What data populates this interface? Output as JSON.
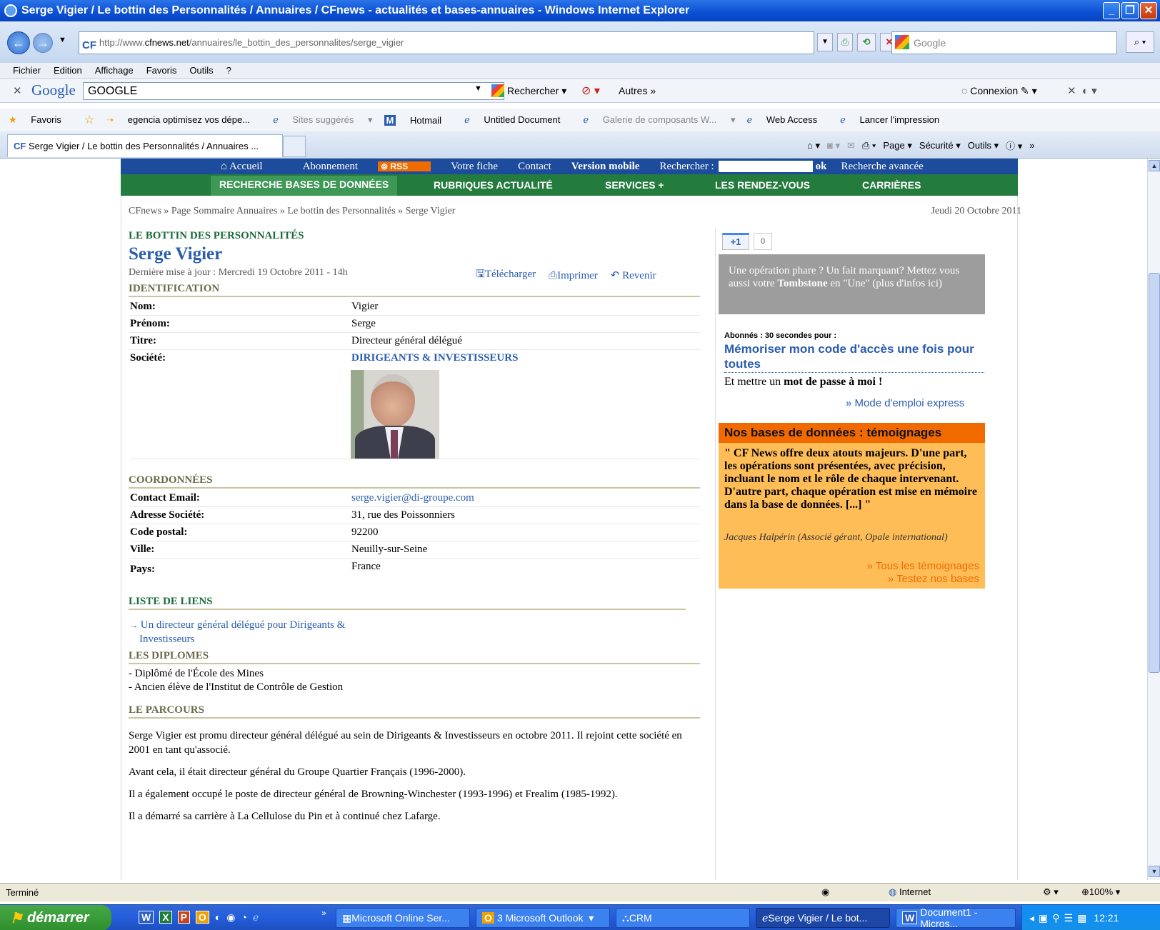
{
  "window": {
    "title": "Serge Vigier / Le bottin des Personnalités / Annuaires / CFnews - actualités et bases-annuaires - Windows Internet Explorer"
  },
  "address": {
    "url_pre": "http://www.",
    "url_host": "cfnews.net",
    "url_post": "/annuaires/le_bottin_des_personnalites/serge_vigier",
    "search_placeholder": "Google"
  },
  "menu": [
    "Fichier",
    "Edition",
    "Affichage",
    "Favoris",
    "Outils",
    "?"
  ],
  "gtoolbar": {
    "logo": "Google",
    "query": "GOOGLE",
    "search": "Rechercher",
    "more": "Autres",
    "connect": "Connexion"
  },
  "favorites": [
    "Favoris",
    "egencia optimisez vos dépe...",
    "Sites suggérés",
    "Hotmail",
    "Untitled Document",
    "Galerie de composants W...",
    "Web Access",
    "Lancer l'impression"
  ],
  "tab": {
    "title": "Serge Vigier / Le bottin des Personnalités / Annuaires ...",
    "page": "Page",
    "security": "Sécurité",
    "tools": "Outils"
  },
  "site": {
    "topnav": [
      "Accueil",
      "Abonnement",
      "RSS",
      "Votre fiche",
      "Contact",
      "Version mobile",
      "Rechercher :"
    ],
    "ok": "ok",
    "advanced": "Recherche avancée",
    "greennav": [
      "RECHERCHE BASES DE DONNÉES",
      "RUBRIQUES ACTUALITÉ",
      "SERVICES +",
      "LES RENDEZ-VOUS",
      "CARRIÈRES"
    ],
    "breadcrumb": "CFnews » Page Sommaire Annuaires » Le bottin des Personnalités » Serge Vigier",
    "date": "Jeudi 20 Octobre 2011"
  },
  "profile": {
    "section": "LE BOTTIN DES PERSONNALITÉS",
    "name": "Serge Vigier",
    "updated": "Dernière mise à jour : Mercredi 19 Octobre 2011 - 14h",
    "actions": [
      "Télécharger",
      "Imprimer",
      "Revenir"
    ],
    "ident_head": "IDENTIFICATION",
    "ident": [
      {
        "k": "Nom:",
        "v": "Vigier"
      },
      {
        "k": "Prénom:",
        "v": "Serge"
      },
      {
        "k": "Titre:",
        "v": "Directeur général délégué"
      },
      {
        "k": "Société:",
        "v": "DIRIGEANTS & INVESTISSEURS"
      }
    ],
    "coord_head": "COORDONNÉES",
    "coord": [
      {
        "k": "Contact Email:",
        "v": "serge.vigier@di-groupe.com"
      },
      {
        "k": "Adresse Société:",
        "v": "31, rue des Poissonniers"
      },
      {
        "k": "Code postal:",
        "v": "92200"
      },
      {
        "k": "Ville:",
        "v": "Neuilly-sur-Seine"
      },
      {
        "k": "Pays:",
        "v": "France"
      }
    ],
    "links_head": "LISTE DE LIENS",
    "link1": "Un directeur général délégué pour Dirigeants &",
    "link2": "Investisseurs",
    "dipl_head": "LES DIPLOMES",
    "dipl": [
      "- Diplômé de l'École des Mines",
      "- Ancien élève de l'Institut de Contrôle de Gestion"
    ],
    "parcours_head": "LE PARCOURS",
    "parcours": [
      "Serge Vigier est promu directeur général délégué au sein de Dirigeants & Investisseurs en octobre 2011. Il rejoint cette société en 2001 en tant qu'associé.",
      "Avant cela, il était directeur général du Groupe Quartier Français (1996-2000).",
      "Il a également occupé le poste de directeur général de Browning-Winchester (1993-1996) et Frealim (1985-1992).",
      "Il a démarré sa carrière à La Cellulose du Pin et à continué chez Lafarge."
    ]
  },
  "right": {
    "plus": "+1",
    "count": "0",
    "tomb1": "Une opération phare ? Un fait marquant? Mettez vous aussi votre ",
    "tomb_b": "Tombstone",
    "tomb2": " en \"Une\" (plus d'infos ici)",
    "abonnes": "Abonnés : 30 secondes pour :",
    "memo": "Mémoriser mon code d'accès une fois pour toutes",
    "pass_pre": "Et mettre un ",
    "pass_b": "mot de passe à moi !",
    "mode": "Mode d'emploi express",
    "temo_head": "Nos bases de données : témoignages",
    "quote": "\" CF News offre deux atouts majeurs. D'une part, les opérations sont présentées, avec précision, incluant le nom et le rôle de chaque intervenant. D'autre part, chaque opération est mise en mémoire dans la base de données. [...] \"",
    "author": "Jacques Halpérin (Associé gérant, Opale international)",
    "all": "Tous les témoignages",
    "test": "Testez nos bases"
  },
  "status": {
    "text": "Terminé",
    "zone": "Internet",
    "zoom": "100%"
  },
  "taskbar": {
    "start": "démarrer",
    "items": [
      "Microsoft Online Ser...",
      "3 Microsoft Outlook",
      "CRM",
      "Serge Vigier / Le bot...",
      "Document1 - Micros..."
    ],
    "clock": "12:21"
  }
}
